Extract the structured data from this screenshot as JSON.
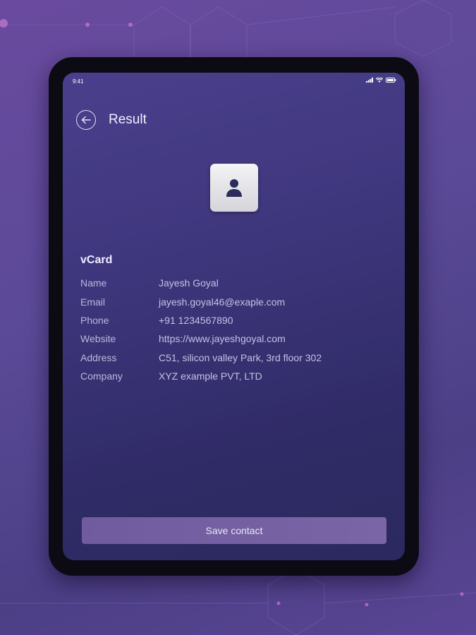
{
  "status_bar": {
    "time": "9:41"
  },
  "header": {
    "title": "Result"
  },
  "vcard": {
    "heading": "vCard",
    "fields": [
      {
        "label": "Name",
        "value": "Jayesh Goyal"
      },
      {
        "label": "Email",
        "value": "jayesh.goyal46@exaple.com"
      },
      {
        "label": "Phone",
        "value": "+91 1234567890"
      },
      {
        "label": "Website",
        "value": "https://www.jayeshgoyal.com"
      },
      {
        "label": "Address",
        "value": "C51, silicon valley Park, 3rd floor 302"
      },
      {
        "label": "Company",
        "value": "XYZ example PVT, LTD"
      }
    ]
  },
  "actions": {
    "save_label": "Save contact"
  },
  "icons": {
    "back": "arrow-left-icon",
    "contact": "person-icon",
    "signal": "signal-icon",
    "wifi": "wifi-icon",
    "battery": "battery-icon"
  },
  "colors": {
    "screen_bg": "#3f377e",
    "button_bg": "#74619f",
    "avatar_tile": "#e8e8ec",
    "person_glyph": "#2b2d5c"
  }
}
